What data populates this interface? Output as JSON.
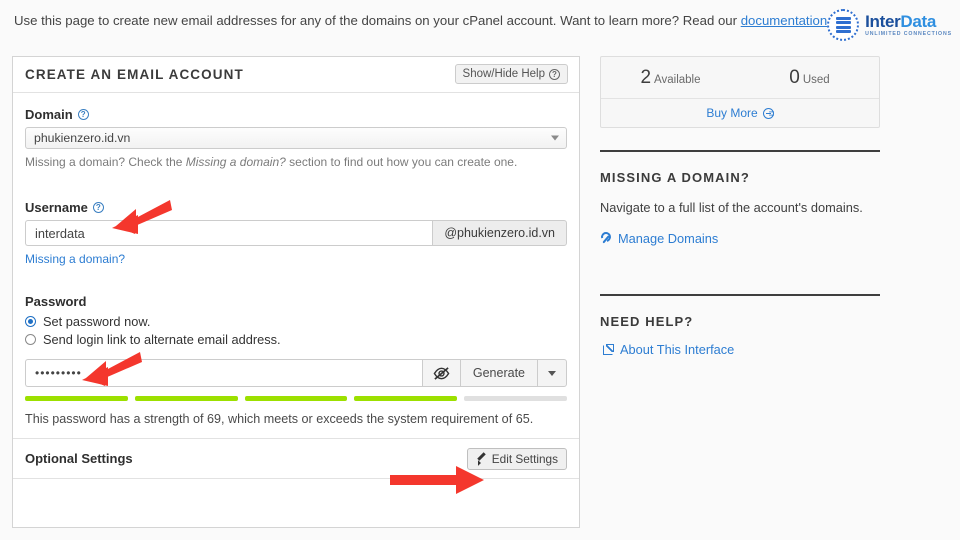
{
  "header": {
    "intro_before": "Use this page to create new email addresses for any of the domains on your cPanel account. Want to learn more? Read our ",
    "doc_link": "documentation",
    "intro_after": ".",
    "logo_name_1": "Inter",
    "logo_name_2": "Data",
    "logo_tagline": "UNLIMITED CONNECTIONS"
  },
  "card": {
    "title": "CREATE AN EMAIL ACCOUNT",
    "show_hide_help": "Show/Hide Help",
    "domain_label": "Domain",
    "domain_value": "phukienzero.id.vn",
    "domain_hint_1": "Missing a domain? Check the ",
    "domain_hint_em": "Missing a domain?",
    "domain_hint_2": " section to find out how you can create one.",
    "username_label": "Username",
    "username_value": "interdata",
    "username_placeholder": "",
    "username_addon": "@phukienzero.id.vn",
    "missing_domain_link": "Missing a domain?",
    "password_label": "Password",
    "radio_set_now": "Set password now.",
    "radio_send_link": "Send login link to alternate email address.",
    "password_value": "•••••••••",
    "eye_icon": "eye-slash-icon",
    "generate_label": "Generate",
    "caret_icon": "chevron-down-icon",
    "strength_segments": [
      true,
      true,
      true,
      true,
      false
    ],
    "strength_message": "This password has a strength of 69, which meets or exceeds the system requirement of 65.",
    "optional_settings_label": "Optional Settings",
    "edit_settings_label": "Edit Settings"
  },
  "rail": {
    "available_num": "2",
    "available_lbl": "Available",
    "used_num": "0",
    "used_lbl": "Used",
    "buy_more": "Buy More",
    "missing_domain_head": "MISSING A DOMAIN?",
    "missing_domain_text": "Navigate to a full list of the account's domains.",
    "manage_domains": "Manage Domains",
    "need_help_head": "NEED HELP?",
    "about_interface": "About This Interface"
  },
  "colors": {
    "link": "#2D7DD2",
    "strength_fill": "#9CE000",
    "strength_empty": "#E0E0E0",
    "annotation": "#F4372D"
  }
}
